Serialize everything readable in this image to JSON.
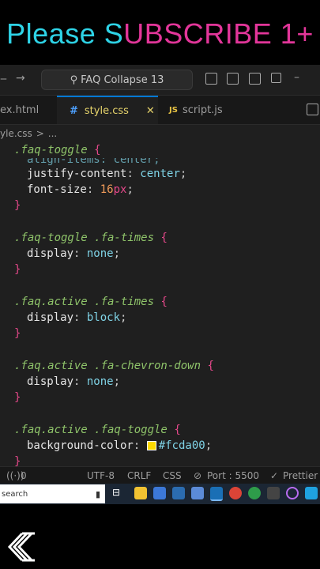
{
  "banner": {
    "part1": "Please S",
    "part2": "UBSCRIBE 1+"
  },
  "titlebar": {
    "command_center": "FAQ Collapse 13",
    "back_icon": "arrow-left-icon",
    "forward_icon": "arrow-right-icon",
    "search_icon": "search-icon"
  },
  "tabs": [
    {
      "label": "ex.html"
    },
    {
      "label": "style.css",
      "prefix": "#",
      "close": "✕"
    },
    {
      "label": "script.js",
      "prefix": "JS"
    }
  ],
  "breadcrumb": {
    "file": "yle.css",
    "sep": ">",
    "rest": "..."
  },
  "code": {
    "l0_sel": ".faq-toggle",
    "l0_brace": "{",
    "l1": "align-items: center;",
    "l2_prop": "justify-content",
    "l2_val": "center",
    "l3_prop": "font-size",
    "l3_num": "16",
    "l3_unit": "px",
    "l4": "}",
    "l6_sel": ".faq-toggle .fa-times",
    "l6_brace": "{",
    "l7_prop": "display",
    "l7_val": "none",
    "l8": "}",
    "l10_sel": ".faq.active .fa-times",
    "l10_brace": "{",
    "l11_prop": "display",
    "l11_val": "block",
    "l12": "}",
    "l14_sel": ".faq.active .fa-chevron-down",
    "l14_brace": "{",
    "l15_prop": "display",
    "l15_val": "none",
    "l16": "}",
    "l18_sel": ".faq.active .faq-toggle",
    "l18_brace": "{",
    "l19_prop": "background-color",
    "l19_val": "#fcda00",
    "l20": "}"
  },
  "status": {
    "errors": "0",
    "encoding": "UTF-8",
    "eol": "CRLF",
    "language": "CSS",
    "port": "Port : 5500",
    "prettier": "Prettier"
  },
  "taskbar": {
    "search_placeholder": "search"
  },
  "colors": {
    "swatch": "#fcda00",
    "accent": "#0078d4"
  }
}
